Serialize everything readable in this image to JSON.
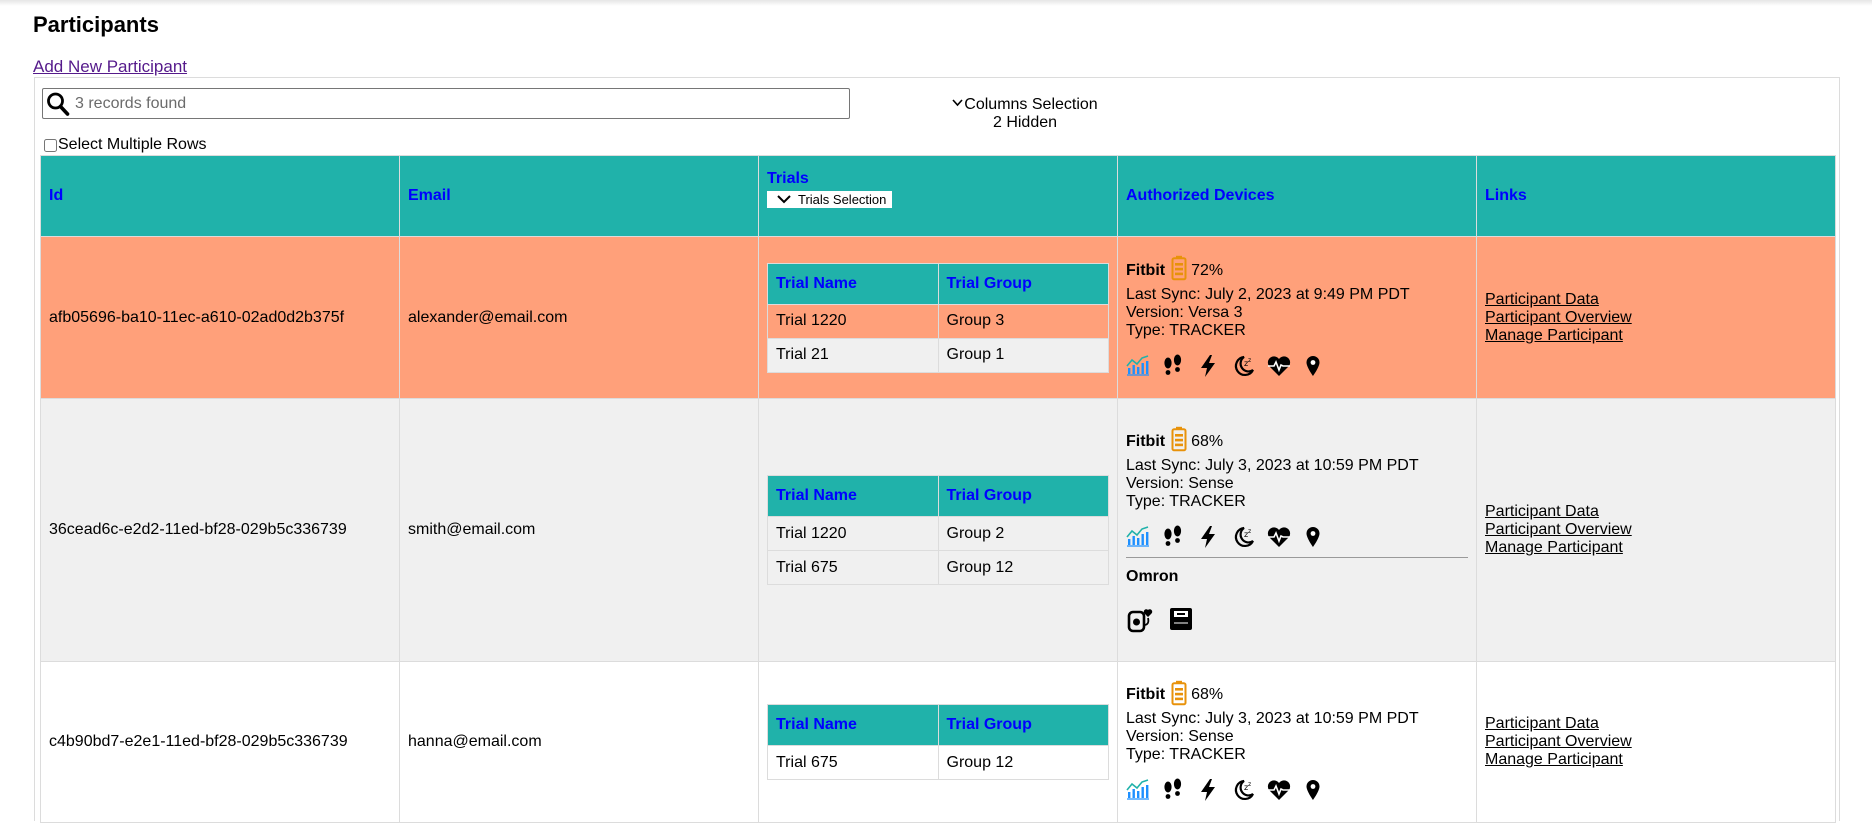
{
  "page": {
    "title": "Participants",
    "add_link": "Add New Participant"
  },
  "search": {
    "placeholder": "3 records found"
  },
  "columns_selection": {
    "label": "Columns Selection",
    "hidden": "2 Hidden"
  },
  "select_multiple": {
    "label": "Select Multiple Rows",
    "checked": false
  },
  "table": {
    "headers": {
      "id": "Id",
      "email": "Email",
      "trials": "Trials",
      "trials_selection": "Trials Selection",
      "devices": "Authorized Devices",
      "links": "Links"
    },
    "trial_headers": {
      "name": "Trial Name",
      "group": "Trial Group"
    },
    "link_labels": [
      "Participant Data",
      "Participant Overview",
      "Manage Participant"
    ],
    "rows": [
      {
        "id": "afb05696-ba10-11ec-a610-02ad0d2b375f",
        "email": "alexander@email.com",
        "row_color": "#ffa07a",
        "trials": [
          {
            "name": "Trial 1220",
            "group": "Group 3"
          },
          {
            "name": "Trial 21",
            "group": "Group 1"
          }
        ],
        "device": {
          "brand": "Fitbit",
          "battery": "72%",
          "last_sync": "Last Sync: July 2, 2023 at 9:49 PM PDT",
          "version": "Version: Versa 3",
          "type": "Type: TRACKER"
        }
      },
      {
        "id": "36cead6c-e2d2-11ed-bf28-029b5c336739",
        "email": "smith@email.com",
        "row_color": "#f0f0f0",
        "trials": [
          {
            "name": "Trial 1220",
            "group": "Group 2"
          },
          {
            "name": "Trial 675",
            "group": "Group 12"
          }
        ],
        "device": {
          "brand": "Fitbit",
          "battery": "68%",
          "last_sync": "Last Sync: July 3, 2023 at 10:59 PM PDT",
          "version": "Version: Sense",
          "type": "Type: TRACKER"
        },
        "device2": {
          "brand": "Omron"
        }
      },
      {
        "id": "c4b90bd7-e2e1-11ed-bf28-029b5c336739",
        "email": "hanna@email.com",
        "row_color": "#ffffff",
        "trials": [
          {
            "name": "Trial 675",
            "group": "Group 12"
          }
        ],
        "device": {
          "brand": "Fitbit",
          "battery": "68%",
          "last_sync": "Last Sync: July 3, 2023 at 10:59 PM PDT",
          "version": "Version: Sense",
          "type": "Type: TRACKER"
        }
      }
    ]
  },
  "fitbit_icons": [
    "activity-chart-icon",
    "footsteps-icon",
    "lightning-icon",
    "sleep-moon-icon",
    "heart-rate-icon",
    "location-pin-icon"
  ],
  "omron_icons": [
    "blood-pressure-icon",
    "scale-icon"
  ],
  "colors": {
    "header_bg": "#20b2aa",
    "header_text": "#0000ff",
    "battery": "#e8920a",
    "highlight_row": "#ffa07a"
  }
}
